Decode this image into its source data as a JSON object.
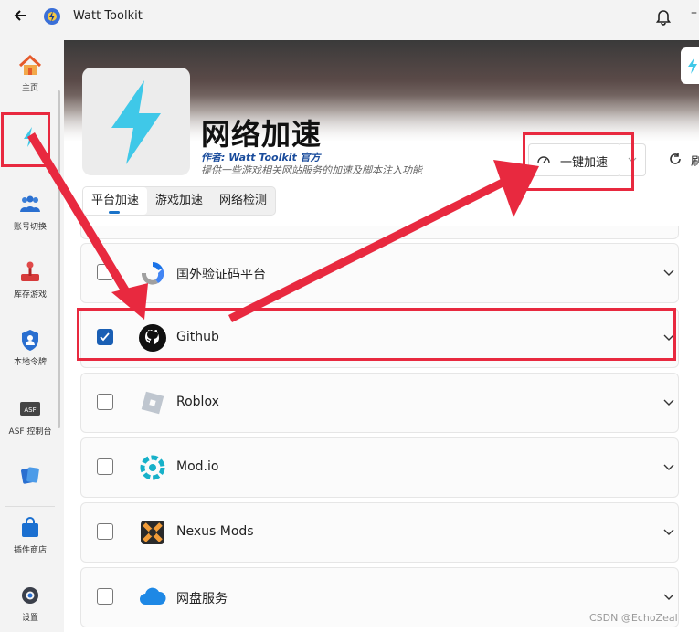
{
  "window": {
    "app_title": "Watt Toolkit",
    "back_icon": "arrow-left-icon",
    "notification_icon": "bell-icon"
  },
  "sidebar": {
    "items": [
      {
        "label": "主页",
        "icon": "home-icon"
      },
      {
        "label": "",
        "icon": "lightning-icon"
      },
      {
        "label": "账号切换",
        "icon": "users-icon"
      },
      {
        "label": "库存游戏",
        "icon": "joystick-icon"
      },
      {
        "label": "本地令牌",
        "icon": "shield-user-icon"
      },
      {
        "label": "ASF 控制台",
        "icon": "asf-icon"
      },
      {
        "label": "",
        "icon": "cards-icon"
      },
      {
        "label": "插件商店",
        "icon": "shopping-bag-icon"
      },
      {
        "label": "设置",
        "icon": "gear-icon"
      }
    ]
  },
  "header": {
    "title": "网络加速",
    "author": "作者:  Watt Toolkit  官方",
    "description": "提供一些游戏相关网站服务的加速及脚本注入功能"
  },
  "tabs": [
    {
      "label": "平台加速",
      "active": true
    },
    {
      "label": "游戏加速",
      "active": false
    },
    {
      "label": "网络检测",
      "active": false
    }
  ],
  "toolbar": {
    "accelerate_label": "一键加速",
    "refresh_label": "刷"
  },
  "services": [
    {
      "label": "国外验证码平台",
      "checked": false,
      "icon": "recaptcha-icon"
    },
    {
      "label": "Github",
      "checked": true,
      "icon": "github-icon"
    },
    {
      "label": "Roblox",
      "checked": false,
      "icon": "roblox-icon"
    },
    {
      "label": "Mod.io",
      "checked": false,
      "icon": "modio-icon"
    },
    {
      "label": "Nexus Mods",
      "checked": false,
      "icon": "nexus-mods-icon"
    },
    {
      "label": "网盘服务",
      "checked": false,
      "icon": "cloud-drive-icon"
    }
  ],
  "watermark": "CSDN @EchoZeal",
  "colors": {
    "accent": "#1a5fb4",
    "annotation_red": "#e8293f",
    "lightning": "#3fc8e8"
  }
}
